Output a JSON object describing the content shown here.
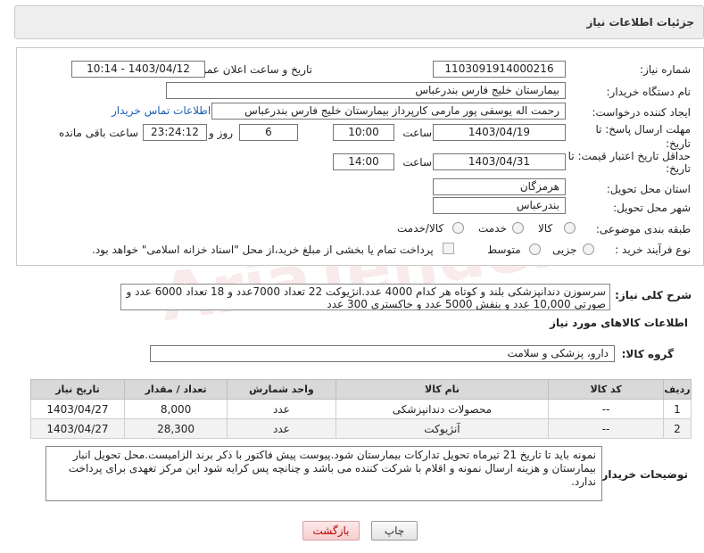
{
  "header": {
    "title": "جزئیات اطلاعات نیاز"
  },
  "form": {
    "need_number_label": "شماره نیاز:",
    "need_number": "1103091914000216",
    "announce_label": "تاریخ و ساعت اعلان عمومی:",
    "announce_value": "1403/04/12 - 10:14",
    "buyer_org_label": "نام دستگاه خریدار:",
    "buyer_org": "بیمارستان خلیج فارس بندرعباس",
    "requester_label": "ایجاد کننده درخواست:",
    "requester": "رحمت اله یوسفی پور مارمی کارپرداز بیمارستان خلیج فارس بندرعباس",
    "contact_link": "اطلاعات تماس خریدار",
    "reply_deadline_label": "مهلت ارسال پاسخ: تا",
    "reply_deadline_label2": "تاریخ:",
    "reply_date": "1403/04/19",
    "time_label": "ساعت",
    "reply_time": "10:00",
    "days_value": "6",
    "days_label": "روز و",
    "remaining_time": "23:24:12",
    "remaining_label": "ساعت باقی مانده",
    "price_validity_label": "حداقل تاریخ اعتبار قیمت: تا",
    "price_validity_label2": "تاریخ:",
    "validity_date": "1403/04/31",
    "validity_time": "14:00",
    "province_label": "استان محل تحویل:",
    "province": "هرمزگان",
    "city_label": "شهر محل تحویل:",
    "city": "بندرعباس",
    "category_label": "طبقه بندی موضوعی:",
    "category_options": [
      "کالا",
      "خدمت",
      "کالا/خدمت"
    ],
    "process_label": "نوع فرآیند خرید :",
    "process_options": [
      "جزیی",
      "متوسط"
    ],
    "payment_note": "پرداخت تمام یا بخشی از مبلغ خرید،از محل \"اسناد خزانه اسلامی\" خواهد بود."
  },
  "description": {
    "label": "شرح کلی نیاز:",
    "text": "سرسوزن دندانپزشکی بلند و کوتاه هر کدام 4000 عدد.انژیوکت 22 تعداد 7000عدد و 18 تعداد 6000 عدد و صورتی 10,000 عدد و بنفش 5000 عدد و خاکستری 300 عدد"
  },
  "goods": {
    "section_title": "اطلاعات کالاهای مورد نیاز",
    "group_label": "گروه کالا:",
    "group_value": "دارو، پزشکی و سلامت",
    "columns": [
      "ردیف",
      "کد کالا",
      "نام کالا",
      "واحد شمارش",
      "تعداد / مقدار",
      "تاریخ نیاز"
    ],
    "rows": [
      {
        "row": "1",
        "code": "--",
        "name": "محصولات دندانپزشکی",
        "unit": "عدد",
        "qty": "8,000",
        "date": "1403/04/27"
      },
      {
        "row": "2",
        "code": "--",
        "name": "آنژیوکت",
        "unit": "عدد",
        "qty": "28,300",
        "date": "1403/04/27"
      }
    ]
  },
  "notes": {
    "label": "توضیحات خریدار:",
    "text": "نمونه باید تا تاریخ 21 تیرماه تحویل تدارکات بیمارستان شود.پیوست پیش فاکتور با ذکر برند الزامیست.محل تحویل انبار بیمارستان و هزینه ارسال نمونه و اقلام با شرکت کننده می باشد و چنانچه پس کرایه شود این مرکز تعهدی برای پرداخت ندارد."
  },
  "buttons": {
    "print": "چاپ",
    "back": "بازگشت"
  },
  "watermark": "AriaTender.net",
  "colors": {
    "link": "#1a5fb4",
    "back_text": "#bb0000"
  }
}
